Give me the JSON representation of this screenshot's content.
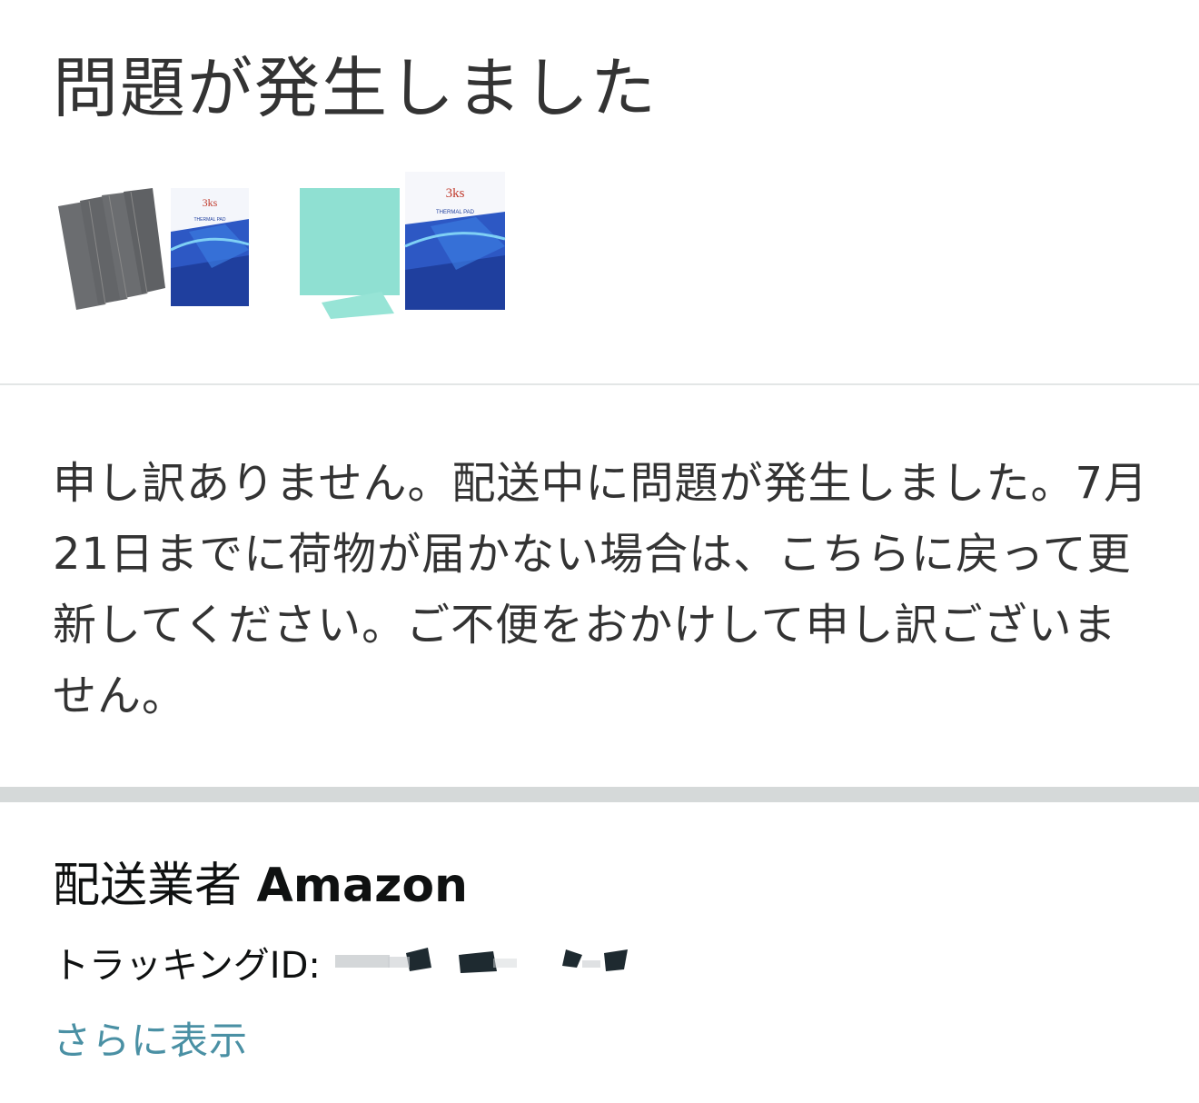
{
  "header": {
    "title": "問題が発生しました"
  },
  "product_images": [
    {
      "icon": "thermal-pad-gray-image",
      "brand": "3ks",
      "label": "THERMAL PAD"
    },
    {
      "icon": "thermal-pad-teal-image",
      "brand": "3ks",
      "label": "THERMAL PAD"
    }
  ],
  "message": {
    "text": "申し訳ありません。配送中に問題が発生しました。7月21日までに荷物が届かない場合は、こちらに戻って更新してください。ご不便をおかけして申し訳ございません。"
  },
  "shipment": {
    "carrier_label": "配送業者",
    "carrier_name": "Amazon",
    "tracking_label": "トラッキングID:",
    "more_link": "さらに表示"
  },
  "colors": {
    "link": "#4a90a4",
    "divider": "#d5d9d9",
    "text": "#333333"
  }
}
